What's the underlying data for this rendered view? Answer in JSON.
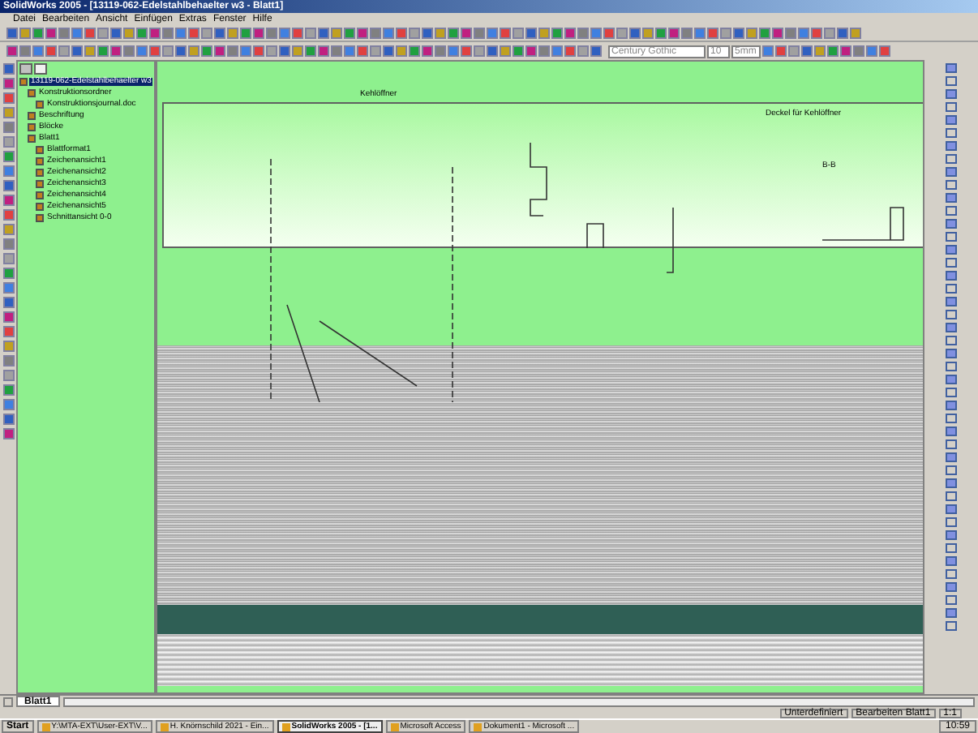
{
  "window": {
    "title": "SolidWorks 2005 - [13119-062-Edelstahlbehaelter w3 - Blatt1]"
  },
  "menu": [
    "Datei",
    "Bearbeiten",
    "Ansicht",
    "Einfügen",
    "Extras",
    "Fenster",
    "Hilfe"
  ],
  "format_bar": {
    "font": "Century Gothic",
    "size": "10",
    "height": "5mm"
  },
  "tree": [
    {
      "label": "13119-062-Edelstahlbehaelter w3",
      "selected": true,
      "children": [
        {
          "label": "Konstruktionsordner",
          "selected": false,
          "children": [
            {
              "label": "Konstruktionsjournal.doc",
              "selected": false
            }
          ]
        },
        {
          "label": "Beschriftung",
          "selected": false
        },
        {
          "label": "Blöcke",
          "selected": false
        },
        {
          "label": "Blatt1",
          "selected": false,
          "children": [
            {
              "label": "Blattformat1",
              "selected": false
            },
            {
              "label": "Zeichenansicht1",
              "selected": false
            },
            {
              "label": "Zeichenansicht2",
              "selected": false
            },
            {
              "label": "Zeichenansicht3",
              "selected": false
            },
            {
              "label": "Zeichenansicht4",
              "selected": false
            },
            {
              "label": "Zeichenansicht5",
              "selected": false
            },
            {
              "label": "Schnittansicht 0-0",
              "selected": false
            }
          ]
        }
      ]
    }
  ],
  "drawing_labels": [
    "Kehlöffner",
    "Deckel für Kehlöffner",
    "B-B"
  ],
  "sheet_tabs": [
    {
      "label": "Blatt1",
      "selected": true
    }
  ],
  "status_bar": [
    "Unterdefiniert",
    "Bearbeiten Blatt1",
    "1:1"
  ],
  "taskbar": {
    "start": "Start",
    "tasks": [
      {
        "label": "Y:\\MTA-EXT\\User-EXT\\V...",
        "selected": false
      },
      {
        "label": "H. Knörnschild 2021 - Ein...",
        "selected": false
      },
      {
        "label": "SolidWorks 2005 - [1...",
        "selected": true
      },
      {
        "label": "Microsoft Access",
        "selected": false
      },
      {
        "label": "Dokument1 - Microsoft ...",
        "selected": false
      }
    ],
    "clock": "10:59"
  }
}
